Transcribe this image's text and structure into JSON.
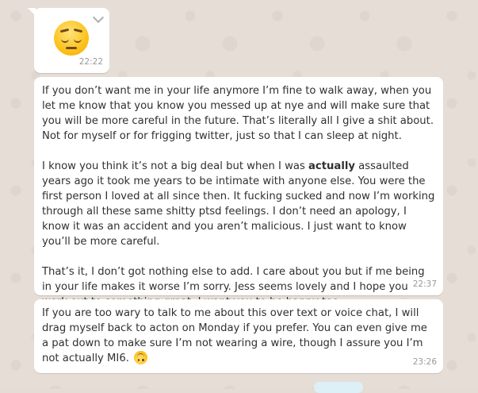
{
  "messages": [
    {
      "type": "emoji",
      "emoji": "pensive-face",
      "time": "22:22"
    },
    {
      "type": "text",
      "paragraphs": [
        "If you don’t want me in your life anymore I’m fine to walk away, when you let me know that you know you messed up at nye and will make sure that you will be more careful in the future. That’s literally all I give a shit about. Not for myself or for frigging twitter, just so that I can sleep at night.",
        {
          "before": "I know you think it’s not a big deal but when I was ",
          "bold": "actually",
          "after": " assaulted years ago it took me years to be intimate with anyone else. You were the first person I loved at all since then. It fucking sucked and now I’m working through all these same shitty ptsd feelings. I don’t need an apology, I know it was an accident and you aren’t malicious. I just want to know you’ll be more careful."
        },
        "That’s it, I don’t got nothing else to add. I care about you but if me being in your life makes it worse I’m sorry. Jess seems lovely and I hope you work out to something great. I want you to be happy too."
      ],
      "time": "22:37"
    },
    {
      "type": "text",
      "text": "If you are too wary to talk to me about this over text or voice chat, I will drag myself back to acton on Monday if you prefer. You can even give me a pat down to make sure I’m not wearing a wire, though I assure you I’m not actually MI6.",
      "trailing_emoji": "upside-down-face",
      "time": "23:26"
    }
  ],
  "colors": {
    "chat_background": "#e5ddd5",
    "incoming_bubble": "#ffffff",
    "text": "#303030",
    "timestamp": "#999999"
  }
}
